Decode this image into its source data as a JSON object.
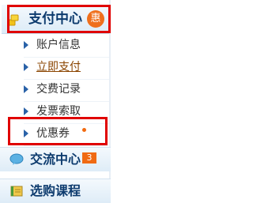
{
  "sidebar": {
    "pay_center": {
      "label": "支付中心",
      "badge": "惠",
      "icon": "coin-stack-icon",
      "highlighted": true
    },
    "pay_items": [
      {
        "label": "账户信息",
        "icon": "arrow-right-icon"
      },
      {
        "label": "立即支付",
        "icon": "arrow-right-icon",
        "active": true
      },
      {
        "label": "交费记录",
        "icon": "arrow-right-icon"
      },
      {
        "label": "发票索取",
        "icon": "arrow-right-icon"
      },
      {
        "label": "优惠券",
        "icon": "arrow-right-icon",
        "new_dot": true,
        "highlighted": true
      }
    ],
    "exchange_center": {
      "label": "交流中心",
      "icon": "chat-bubble-icon",
      "count": "3"
    },
    "course_select": {
      "label": "选购课程",
      "icon": "book-icon"
    }
  },
  "colors": {
    "highlight_border": "#e00000",
    "badge_orange": "#ef6f1c",
    "heading_blue": "#0d3b6e",
    "arrow_blue": "#2a62a8"
  }
}
